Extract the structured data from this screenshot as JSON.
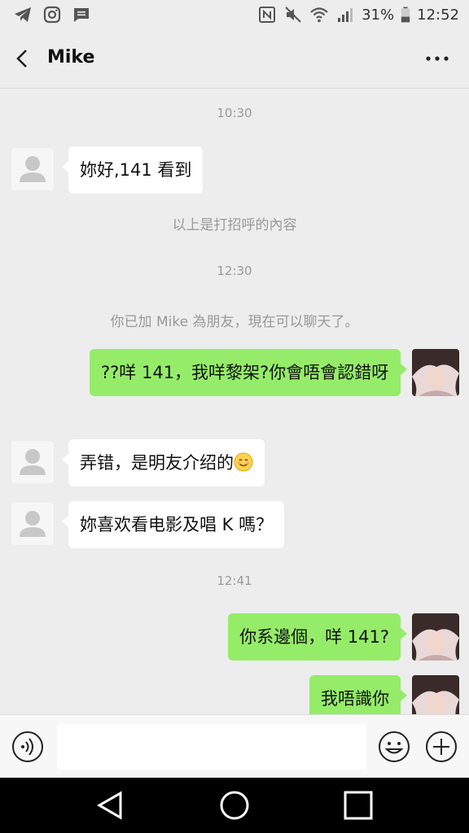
{
  "status_bar": {
    "battery": "31%",
    "time": "12:52"
  },
  "header": {
    "title": "Mike"
  },
  "chat": {
    "time1": "10:30",
    "msg1": "妳好,141 看到",
    "sys1": "以上是打招呼的內容",
    "time2": "12:30",
    "sys2": "你已加 Mike 為朋友，現在可以聊天了。",
    "msg2": "??咩 141，我咩黎架?你會唔會認錯呀",
    "msg3": "弄错，是明友介绍的",
    "msg4": "妳喜欢看电影及唱 K 嗎？",
    "time3": "12:41",
    "msg5": "你系邊個，咩 141?",
    "msg6": "我唔識你"
  },
  "colors": {
    "outgoing_bubble": "#95ec69",
    "incoming_bubble": "#ffffff",
    "background": "#ededed"
  },
  "icons": [
    "telegram-icon",
    "instagram-icon",
    "message-icon",
    "nfc-icon",
    "mute-icon",
    "wifi-icon",
    "signal-icon",
    "battery-icon",
    "back-icon",
    "more-icon",
    "voice-icon",
    "smile-icon",
    "plus-icon",
    "nav-back-icon",
    "nav-home-icon",
    "nav-recents-icon"
  ]
}
